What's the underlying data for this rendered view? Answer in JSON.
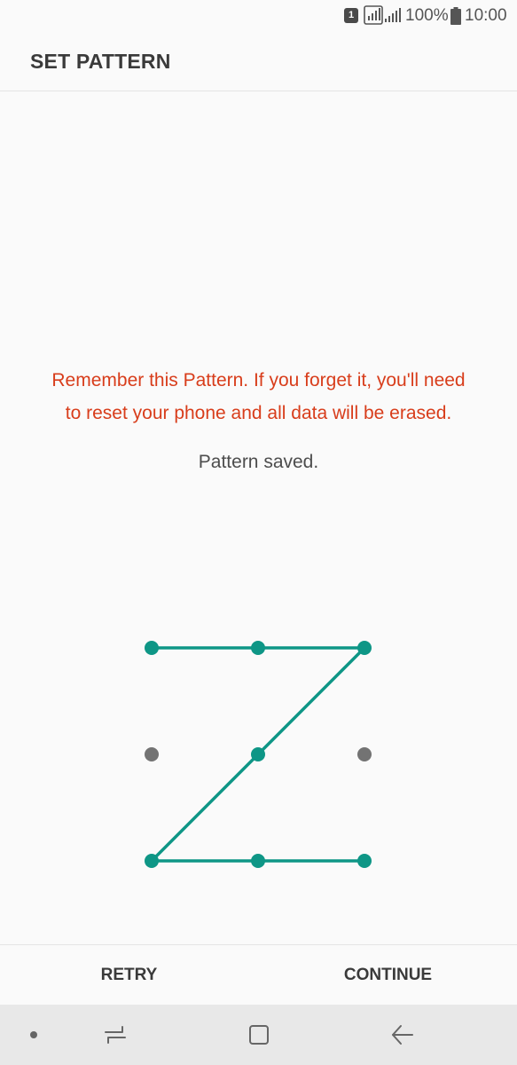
{
  "status_bar": {
    "sim_label": "1",
    "battery_percent": "100%",
    "time": "10:00"
  },
  "header": {
    "title": "SET PATTERN"
  },
  "message": {
    "warning_line1": "Remember this Pattern. If you forget it, you'll need",
    "warning_line2": "to reset your phone and all data will be erased.",
    "status": "Pattern saved."
  },
  "pattern": {
    "grid": "3x3",
    "drawn_sequence": [
      1,
      2,
      3,
      5,
      7,
      8,
      9
    ],
    "unselected_dots": [
      4,
      6
    ],
    "color_active": "#0e9686",
    "color_inactive": "#737373"
  },
  "buttons": {
    "retry": "RETRY",
    "continue": "CONTINUE"
  },
  "nav_bar": {
    "items": [
      "dot-icon",
      "recent-apps-icon",
      "home-icon",
      "back-icon"
    ]
  },
  "colors": {
    "warning": "#d83d1b",
    "accent": "#0e9686",
    "text": "#3a3a3a"
  }
}
